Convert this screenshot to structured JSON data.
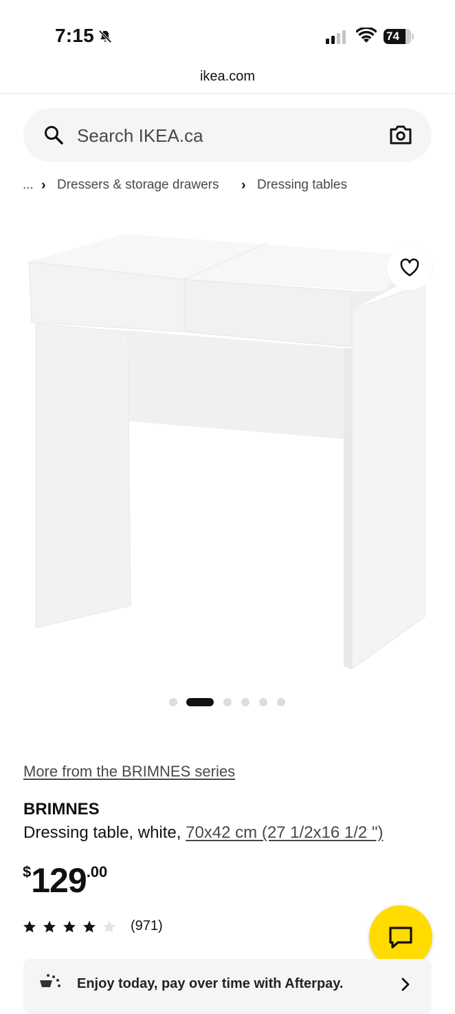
{
  "status_bar": {
    "time": "7:15",
    "battery": "74"
  },
  "browser": {
    "url": "ikea.com"
  },
  "search": {
    "placeholder": "Search IKEA.ca"
  },
  "breadcrumb": {
    "ellipsis": "...",
    "items": [
      "Dressers & storage drawers",
      "Dressing tables"
    ]
  },
  "gallery": {
    "image_count": 6,
    "active_index": 1
  },
  "product": {
    "series_link": "More from the BRIMNES series",
    "name": "BRIMNES",
    "description": "Dressing table, white, ",
    "size_link": "70x42 cm (27 1/2x16 1/2 \")",
    "price": {
      "currency": "$",
      "whole": "129",
      "decimal": ".00"
    },
    "rating": {
      "stars": 4.5,
      "count": "(971)"
    }
  },
  "afterpay": {
    "text": "Enjoy today, pay over time with Afterpay."
  },
  "colors": {
    "accent_yellow": "#ffdb00",
    "text": "#111111",
    "muted": "#484848",
    "surface": "#f5f5f5"
  }
}
